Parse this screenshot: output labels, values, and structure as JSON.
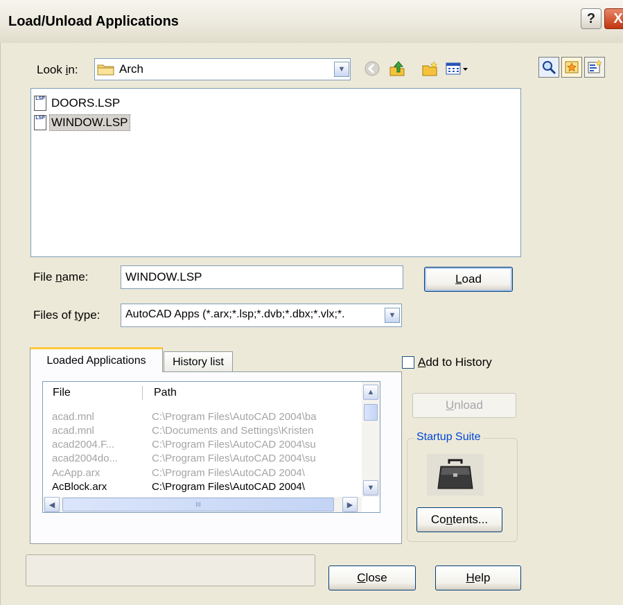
{
  "window": {
    "title": "Load/Unload Applications",
    "help_glyph": "?",
    "close_glyph": "X"
  },
  "lookin": {
    "label_pre": "Look ",
    "label_accel": "i",
    "label_post": "n:",
    "value": "Arch"
  },
  "toolbar_icons": [
    "back-icon",
    "up-folder-icon",
    "new-folder-icon",
    "views-menu-icon"
  ],
  "right_icons": [
    "find-icon",
    "locate-icon",
    "add-to-favorites-icon"
  ],
  "files": [
    {
      "name": "DOORS.LSP",
      "icon_text": "LSP",
      "selected": false
    },
    {
      "name": "WINDOW.LSP",
      "icon_text": "LSP",
      "selected": true
    }
  ],
  "filename": {
    "label_pre": "File ",
    "label_accel": "n",
    "label_post": "ame:",
    "value": "WINDOW.LSP"
  },
  "filetype": {
    "label_pre": "Files of ",
    "label_accel": "t",
    "label_post": "ype:",
    "value": "AutoCAD Apps (*.arx;*.lsp;*.dvb;*.dbx;*.vlx;*."
  },
  "load_button": {
    "accel": "L",
    "rest": "oad"
  },
  "tabs": {
    "active": "Loaded Applications",
    "inactive": "History list"
  },
  "table": {
    "headers": [
      "File",
      "Path"
    ],
    "rows": [
      {
        "file": "acad.mnl",
        "path": "C:\\Program Files\\AutoCAD 2004\\ba",
        "dim": true
      },
      {
        "file": "acad.mnl",
        "path": "C:\\Documents and Settings\\Kristen",
        "dim": true
      },
      {
        "file": "acad2004.F...",
        "path": "C:\\Program Files\\AutoCAD 2004\\su",
        "dim": true
      },
      {
        "file": "acad2004do...",
        "path": "C:\\Program Files\\AutoCAD 2004\\su",
        "dim": true
      },
      {
        "file": "AcApp.arx",
        "path": "C:\\Program Files\\AutoCAD 2004\\",
        "dim": true
      },
      {
        "file": "AcBlock.arx",
        "path": "C:\\Program Files\\AutoCAD 2004\\",
        "dim": false
      }
    ],
    "hscroll_grip": "III"
  },
  "add_to_history": {
    "accel": "A",
    "rest": "dd to History",
    "checked": false
  },
  "unload_button": {
    "accel": "U",
    "rest": "nload"
  },
  "startup_suite": {
    "label": "Startup Suite",
    "contents_accel": "n",
    "contents_pre": "Co",
    "contents_post": "tents..."
  },
  "close_button": {
    "accel": "C",
    "rest": "lose"
  },
  "help_button": {
    "accel": "H",
    "rest": "elp"
  },
  "colors": {
    "dialog_bg": "#ece9d8",
    "disabled_text": "#a4a4a4",
    "group_label": "#0046d5",
    "tab_highlight": "#ffc83c"
  }
}
